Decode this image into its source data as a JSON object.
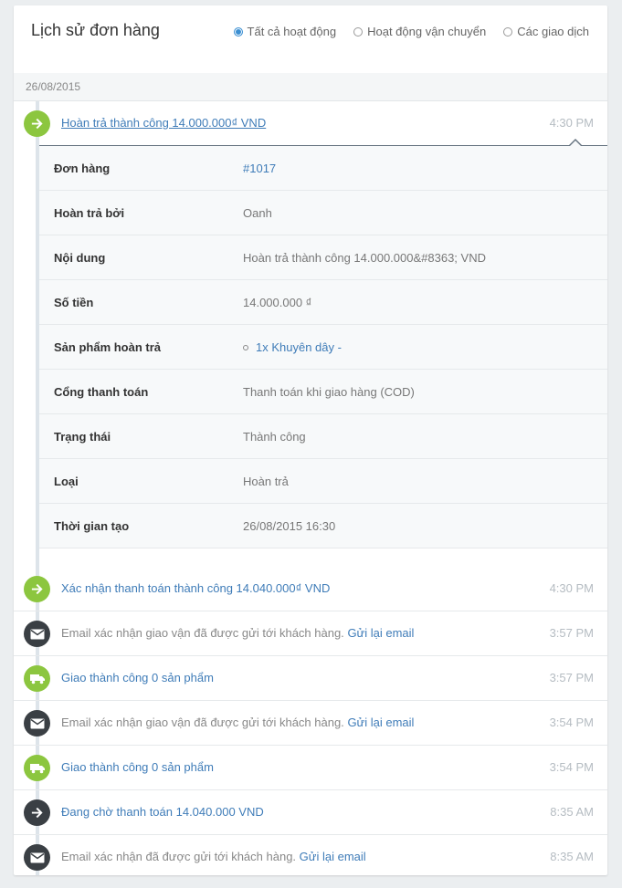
{
  "header": {
    "title": "Lịch sử đơn hàng",
    "filters": [
      {
        "label": "Tất cả hoạt động",
        "checked": true
      },
      {
        "label": "Hoạt động vận chuyển",
        "checked": false
      },
      {
        "label": "Các giao dịch",
        "checked": false
      }
    ]
  },
  "date": "26/08/2015",
  "expanded_event": {
    "icon": "arrow-right-icon",
    "message": "Hoàn trả thành công 14.000.000₫ VND",
    "time": "4:30 PM",
    "details": [
      {
        "label": "Đơn hàng",
        "value": "#1017"
      },
      {
        "label": "Hoàn trả bởi",
        "value": "Oanh"
      },
      {
        "label": "Nội dung",
        "value": "Hoàn trả thành công 14.000.000&#8363; VND"
      },
      {
        "label": "Số tiền",
        "value": "14.000.000 ₫"
      },
      {
        "label": "Sản phẩm hoàn trả",
        "qty": "1x",
        "product": "Khuyên dây",
        "suffix": " -"
      },
      {
        "label": "Cổng thanh toán",
        "value": "Thanh toán khi giao hàng (COD)"
      },
      {
        "label": "Trạng thái",
        "value": "Thành công"
      },
      {
        "label": "Loại",
        "value": "Hoàn trả"
      },
      {
        "label": "Thời gian tạo",
        "value": "26/08/2015 16:30"
      }
    ]
  },
  "events": [
    {
      "icon": "arrow-right-icon",
      "message": "Xác nhận thanh toán thành công 14.040.000₫ VND",
      "link": "",
      "time": "4:30 PM"
    },
    {
      "icon": "envelope-icon",
      "message": "Email xác nhận giao vận đã được gửi tới khách hàng.",
      "link": "Gửi lại email",
      "time": "3:57 PM"
    },
    {
      "icon": "truck-icon",
      "message": "Giao thành công 0 sản phẩm",
      "link": "",
      "time": "3:57 PM"
    },
    {
      "icon": "envelope-icon",
      "message": "Email xác nhận giao vận đã được gửi tới khách hàng.",
      "link": "Gửi lại email",
      "time": "3:54 PM"
    },
    {
      "icon": "truck-icon",
      "message": "Giao thành công 0 sản phẩm",
      "link": "",
      "time": "3:54 PM"
    },
    {
      "icon": "arrow-right-icon",
      "message": "Đang chờ thanh toán 14.040.000 VND",
      "link": "",
      "time": "8:35 AM"
    },
    {
      "icon": "envelope-icon",
      "message": "Email xác nhận đã được gửi tới khách hàng.",
      "link": "Gửi lại email",
      "time": "8:35 AM"
    }
  ],
  "colors": {
    "accent": "#3f7cb8",
    "green_icon": "#8cc63f",
    "dark_icon": "#3a3f44",
    "timeline": "#dde4ea"
  }
}
